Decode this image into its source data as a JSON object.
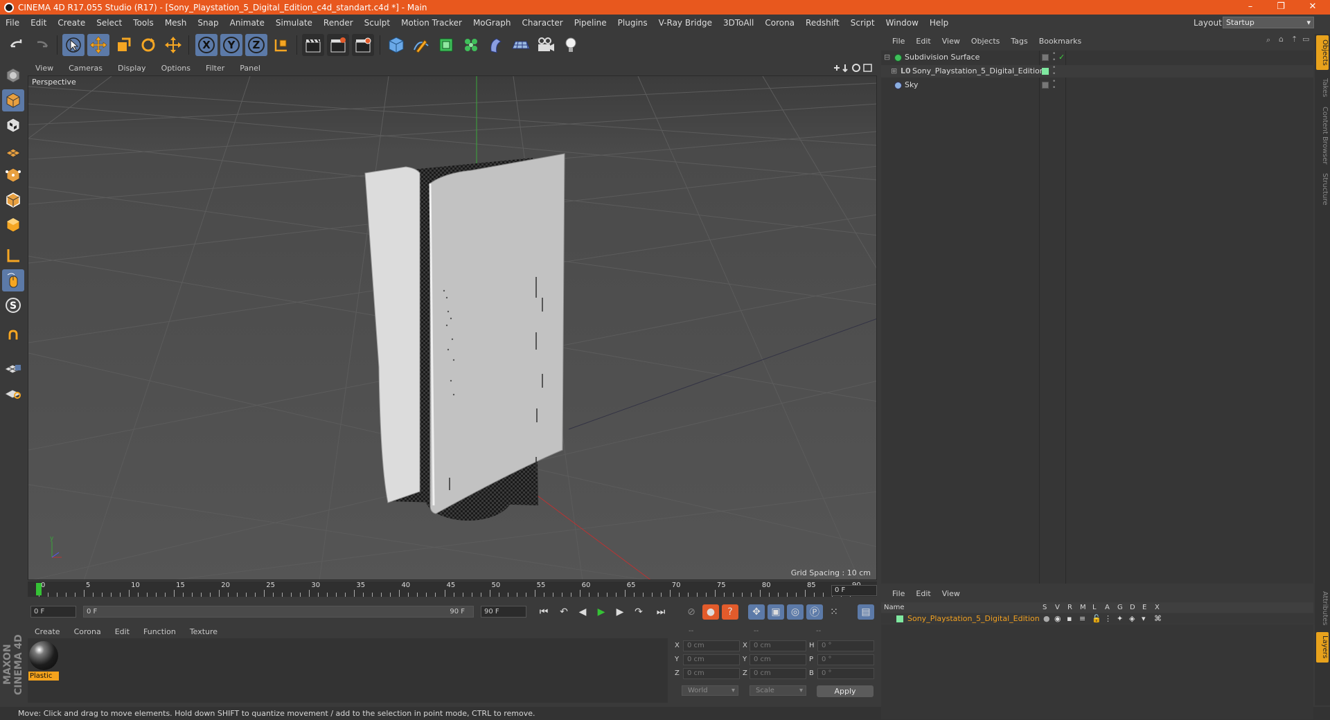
{
  "window": {
    "title": "CINEMA 4D R17.055 Studio (R17) - [Sony_Playstation_5_Digital_Edition_c4d_standart.c4d *] - Main",
    "controls": [
      "–",
      "❐",
      "✕"
    ]
  },
  "menubar": {
    "items": [
      "File",
      "Edit",
      "Create",
      "Select",
      "Tools",
      "Mesh",
      "Snap",
      "Animate",
      "Simulate",
      "Render",
      "Sculpt",
      "Motion Tracker",
      "MoGraph",
      "Character",
      "Pipeline",
      "Plugins",
      "V-Ray Bridge",
      "3DToAll",
      "Corona",
      "Redshift",
      "Script",
      "Window",
      "Help"
    ],
    "layout_label": "Layout:",
    "layout_value": "Startup"
  },
  "viewport": {
    "menu": [
      "View",
      "Cameras",
      "Display",
      "Options",
      "Filter",
      "Panel"
    ],
    "label": "Perspective",
    "grid_spacing": "Grid Spacing : 10 cm"
  },
  "timeline": {
    "ticks": [
      "0",
      "5",
      "10",
      "15",
      "20",
      "25",
      "30",
      "35",
      "40",
      "45",
      "50",
      "55",
      "60",
      "65",
      "70",
      "75",
      "80",
      "85",
      "90"
    ],
    "current_frame": "0 F",
    "start_field": "0 F",
    "range_start": "0 F",
    "range_end": "90 F",
    "end_field": "90 F"
  },
  "material_manager": {
    "menu": [
      "Create",
      "Corona",
      "Edit",
      "Function",
      "Texture"
    ],
    "materials": [
      {
        "name": "Plastic"
      }
    ]
  },
  "coordinates": {
    "headers": [
      "--",
      "--",
      "--"
    ],
    "rows": [
      {
        "a": "X",
        "av": "0 cm",
        "b": "X",
        "bv": "0 cm",
        "c": "H",
        "cv": "0 °"
      },
      {
        "a": "Y",
        "av": "0 cm",
        "b": "Y",
        "bv": "0 cm",
        "c": "P",
        "cv": "0 °"
      },
      {
        "a": "Z",
        "av": "0 cm",
        "b": "Z",
        "bv": "0 cm",
        "c": "B",
        "cv": "0 °"
      }
    ],
    "space": "World",
    "mode": "Scale",
    "apply": "Apply"
  },
  "status_bar": "Move: Click and drag to move elements. Hold down SHIFT to quantize movement / add to the selection in point mode, CTRL to remove.",
  "object_manager": {
    "menu": [
      "File",
      "Edit",
      "View",
      "Objects",
      "Tags",
      "Bookmarks"
    ],
    "objects": [
      {
        "name": "Subdivision Surface",
        "indent": 0
      },
      {
        "name": "Sony_Playstation_5_Digital_Edition",
        "indent": 1
      },
      {
        "name": "Sky",
        "indent": 0
      }
    ]
  },
  "layer_manager": {
    "menu": [
      "File",
      "Edit",
      "View"
    ],
    "header": "Name",
    "columns": [
      "S",
      "V",
      "R",
      "M",
      "L",
      "A",
      "G",
      "D",
      "E",
      "X"
    ],
    "layers": [
      {
        "name": "Sony_Playstation_5_Digital_Edition"
      }
    ]
  },
  "right_tabs": [
    "Objects",
    "Takes",
    "Content Browser",
    "Structure",
    "Attributes",
    "Layers"
  ],
  "branding": "MAXON CINEMA 4D",
  "colors": {
    "titlebar": "#e8581e",
    "accent_blue": "#5c7aa8",
    "material_label": "#f4a21c",
    "layer_name": "#f0a020"
  }
}
